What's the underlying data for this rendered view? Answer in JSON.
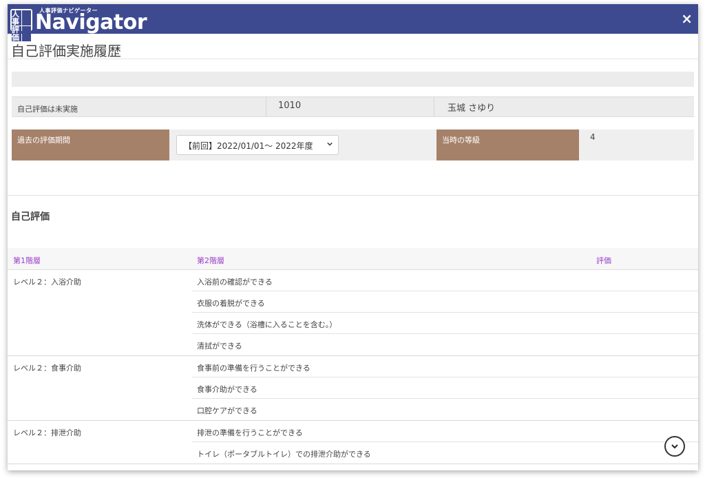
{
  "header": {
    "logo_badge": [
      "人事",
      "",
      "評価",
      ""
    ],
    "logo_sub": "人事評価ナビゲーター",
    "logo_main": "Navigator",
    "close_label": "×"
  },
  "page": {
    "title": "自己評価実施履歴"
  },
  "info": {
    "status": "自己評価は未実施",
    "employee_id": "1010",
    "employee_name": "玉城 さゆり"
  },
  "period": {
    "label": "過去の評価期間",
    "selected": "【前回】2022/01/01～ 2022年度",
    "grade_label": "当時の等級",
    "grade_value": "4"
  },
  "section": {
    "title": "自己評価"
  },
  "table": {
    "headers": [
      "第1階層",
      "第2階層",
      "評価"
    ],
    "groups": [
      {
        "level": "レベル２：入浴介助",
        "items": [
          "入浴前の確認ができる",
          "衣服の着脱ができる",
          "洗体ができる（浴槽に入ることを含む。）",
          "清拭ができる"
        ]
      },
      {
        "level": "レベル２：食事介助",
        "items": [
          "食事前の準備を行うことができる",
          "食事介助ができる",
          "口腔ケアができる"
        ]
      },
      {
        "level": "レベル２：排泄介助",
        "items": [
          "排泄の準備を行うことができる",
          "トイレ（ポータブルトイレ）での排泄介助ができる"
        ]
      }
    ]
  },
  "icons": {
    "close": "close-icon",
    "select_chevron": "chevron-down-icon",
    "scroll": "chevron-down-circle-icon"
  },
  "colors": {
    "titlebar": "#3e4a8f",
    "label_brown": "#a6816a",
    "header_purple": "#9b3ec9"
  }
}
